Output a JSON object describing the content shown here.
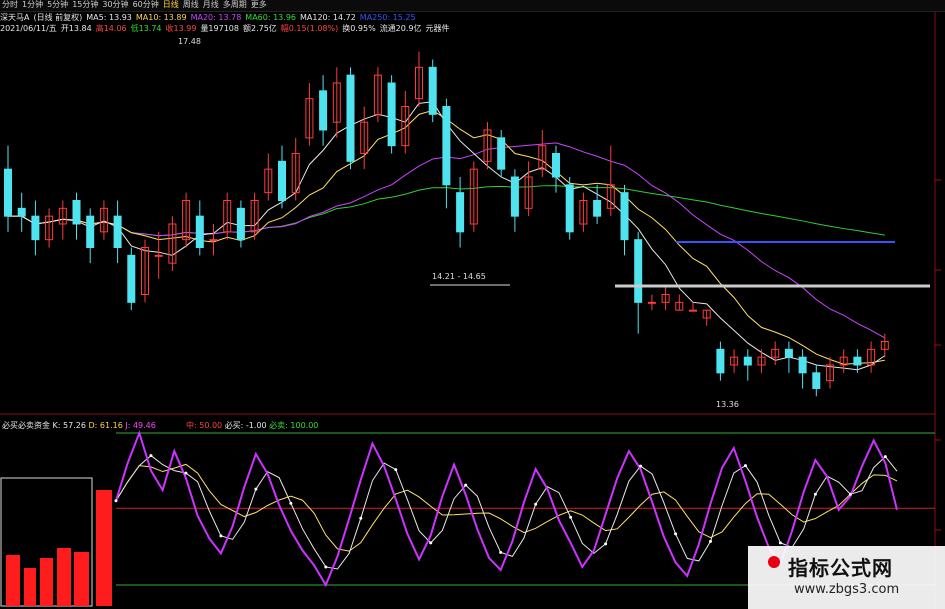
{
  "toolbar": {
    "periods": [
      "分时",
      "1分钟",
      "5分钟",
      "15分钟",
      "30分钟",
      "60分钟",
      "日线",
      "周线",
      "月线",
      "多周期",
      "更多"
    ],
    "active_index": 6
  },
  "header": {
    "stock": "深天马A",
    "mode": "(日线 前复权)",
    "ma5": "MA5: 13.93",
    "ma10": "MA10: 13.89",
    "ma20": "MA20: 13.78",
    "ma60": "MA60: 13.96",
    "ma120": "MA120: 14.72",
    "ma250": "MA250: 15.25"
  },
  "quote": {
    "date": "2021/06/11/五",
    "open": "开13.84",
    "high": "高14.06",
    "low": "低13.74",
    "close": "收13.99",
    "volume": "量197108",
    "amount": "额2.75亿",
    "change": "幅0.15(1.08%)",
    "turnover": "换0.95%",
    "float_cap": "流通20.9亿",
    "unit": "元器件"
  },
  "annotations": {
    "high_label": "17.48",
    "range_label": "14.21 - 14.65",
    "low_label": "13.36"
  },
  "indicator": {
    "name": "必买必卖资金",
    "k": "K: 57.26",
    "d": "D: 61.16",
    "j": "J: 49.46",
    "mid": "中: 50.00",
    "buy": "必买: -1.00",
    "sell": "必卖: 100.00"
  },
  "watermark": {
    "cn": "指标公式网",
    "url": "www.zbgs3.com"
  },
  "colors": {
    "up": "#ff3b3b",
    "down": "#4fe3f0",
    "ma5": "#e8e8e8",
    "ma10": "#ffe066",
    "ma20": "#cc44ff",
    "ma60": "#33cc33",
    "ma120": "#9a9a9a",
    "ma250": "#3355ff"
  },
  "chart_data": {
    "type": "candlestick",
    "ylim": [
      13.2,
      18.0
    ],
    "candles": [
      [
        16.3,
        15.7,
        16.6,
        15.5
      ],
      [
        15.8,
        15.7,
        16.0,
        15.5
      ],
      [
        15.7,
        15.4,
        15.9,
        15.2
      ],
      [
        15.4,
        15.7,
        15.8,
        15.3
      ],
      [
        15.6,
        15.8,
        15.9,
        15.4
      ],
      [
        15.9,
        15.6,
        16.0,
        15.4
      ],
      [
        15.7,
        15.3,
        15.8,
        15.1
      ],
      [
        15.5,
        15.8,
        15.9,
        15.4
      ],
      [
        15.7,
        15.3,
        15.9,
        15.1
      ],
      [
        15.2,
        14.6,
        15.3,
        14.5
      ],
      [
        14.7,
        15.3,
        15.4,
        14.6
      ],
      [
        15.2,
        15.2,
        15.5,
        14.9
      ],
      [
        15.1,
        15.6,
        15.7,
        15.0
      ],
      [
        15.4,
        15.9,
        16.0,
        15.3
      ],
      [
        15.7,
        15.3,
        15.9,
        15.2
      ],
      [
        15.4,
        15.4,
        15.6,
        15.2
      ],
      [
        15.5,
        15.9,
        16.0,
        15.4
      ],
      [
        15.8,
        15.4,
        15.9,
        15.3
      ],
      [
        15.5,
        15.9,
        16.0,
        15.4
      ],
      [
        16.0,
        16.3,
        16.5,
        15.9
      ],
      [
        16.4,
        15.9,
        16.6,
        15.8
      ],
      [
        16.0,
        16.5,
        16.7,
        15.9
      ],
      [
        16.7,
        17.2,
        17.4,
        16.6
      ],
      [
        17.3,
        16.8,
        17.5,
        16.6
      ],
      [
        16.9,
        17.4,
        17.6,
        16.7
      ],
      [
        17.5,
        16.4,
        17.6,
        16.3
      ],
      [
        16.5,
        16.9,
        17.1,
        16.3
      ],
      [
        17.0,
        17.5,
        17.6,
        16.9
      ],
      [
        17.4,
        16.6,
        17.5,
        16.5
      ],
      [
        16.6,
        17.1,
        17.3,
        16.5
      ],
      [
        17.2,
        17.6,
        17.8,
        17.1
      ],
      [
        17.6,
        17.0,
        17.7,
        16.9
      ],
      [
        17.1,
        16.1,
        17.2,
        15.8
      ],
      [
        16.0,
        15.5,
        16.2,
        15.3
      ],
      [
        15.6,
        16.3,
        16.4,
        15.5
      ],
      [
        16.4,
        16.8,
        16.9,
        16.3
      ],
      [
        16.7,
        16.3,
        16.8,
        16.2
      ],
      [
        16.2,
        15.7,
        16.3,
        15.5
      ],
      [
        15.8,
        16.2,
        16.4,
        15.7
      ],
      [
        16.3,
        16.6,
        16.8,
        16.2
      ],
      [
        16.5,
        16.2,
        16.6,
        16.0
      ],
      [
        16.1,
        15.5,
        16.2,
        15.4
      ],
      [
        15.6,
        15.9,
        16.0,
        15.5
      ],
      [
        15.9,
        15.7,
        16.1,
        15.6
      ],
      [
        15.8,
        16.1,
        16.6,
        15.7
      ],
      [
        16.0,
        15.4,
        16.1,
        15.2
      ],
      [
        15.4,
        14.6,
        15.5,
        14.2
      ],
      [
        14.6,
        14.6,
        14.7,
        14.5
      ],
      [
        14.6,
        14.7,
        14.8,
        14.5
      ],
      [
        14.5,
        14.6,
        14.7,
        14.5
      ],
      [
        14.5,
        14.5,
        14.6,
        14.5
      ],
      [
        14.4,
        14.5,
        14.5,
        14.3
      ],
      [
        14.0,
        13.7,
        14.1,
        13.6
      ],
      [
        13.8,
        13.9,
        14.0,
        13.7
      ],
      [
        13.9,
        13.8,
        14.0,
        13.6
      ],
      [
        13.8,
        13.9,
        14.0,
        13.7
      ],
      [
        13.9,
        14.0,
        14.1,
        13.8
      ],
      [
        14.0,
        13.9,
        14.1,
        13.7
      ],
      [
        13.9,
        13.7,
        14.0,
        13.5
      ],
      [
        13.7,
        13.5,
        13.8,
        13.4
      ],
      [
        13.6,
        13.8,
        13.9,
        13.5
      ],
      [
        13.8,
        13.9,
        14.0,
        13.7
      ],
      [
        13.9,
        13.8,
        14.0,
        13.7
      ],
      [
        13.8,
        14.0,
        14.1,
        13.7
      ],
      [
        14.0,
        14.1,
        14.2,
        13.9
      ]
    ],
    "indicator_series": {
      "mid": 50,
      "buy_line": -1,
      "sell_line": 100,
      "j": [
        55,
        80,
        100,
        75,
        62,
        88,
        70,
        45,
        30,
        20,
        38,
        64,
        86,
        73,
        52,
        35,
        22,
        12,
        -1,
        18,
        43,
        69,
        93,
        78,
        56,
        33,
        16,
        32,
        58,
        79,
        59,
        36,
        17,
        9,
        28,
        54,
        76,
        63,
        42,
        27,
        11,
        22,
        46,
        70,
        88,
        76,
        54,
        31,
        14,
        5,
        26,
        53,
        77,
        90,
        68,
        44,
        24,
        13,
        35,
        61,
        82,
        71,
        49,
        58,
        78,
        95,
        80,
        49
      ]
    }
  }
}
